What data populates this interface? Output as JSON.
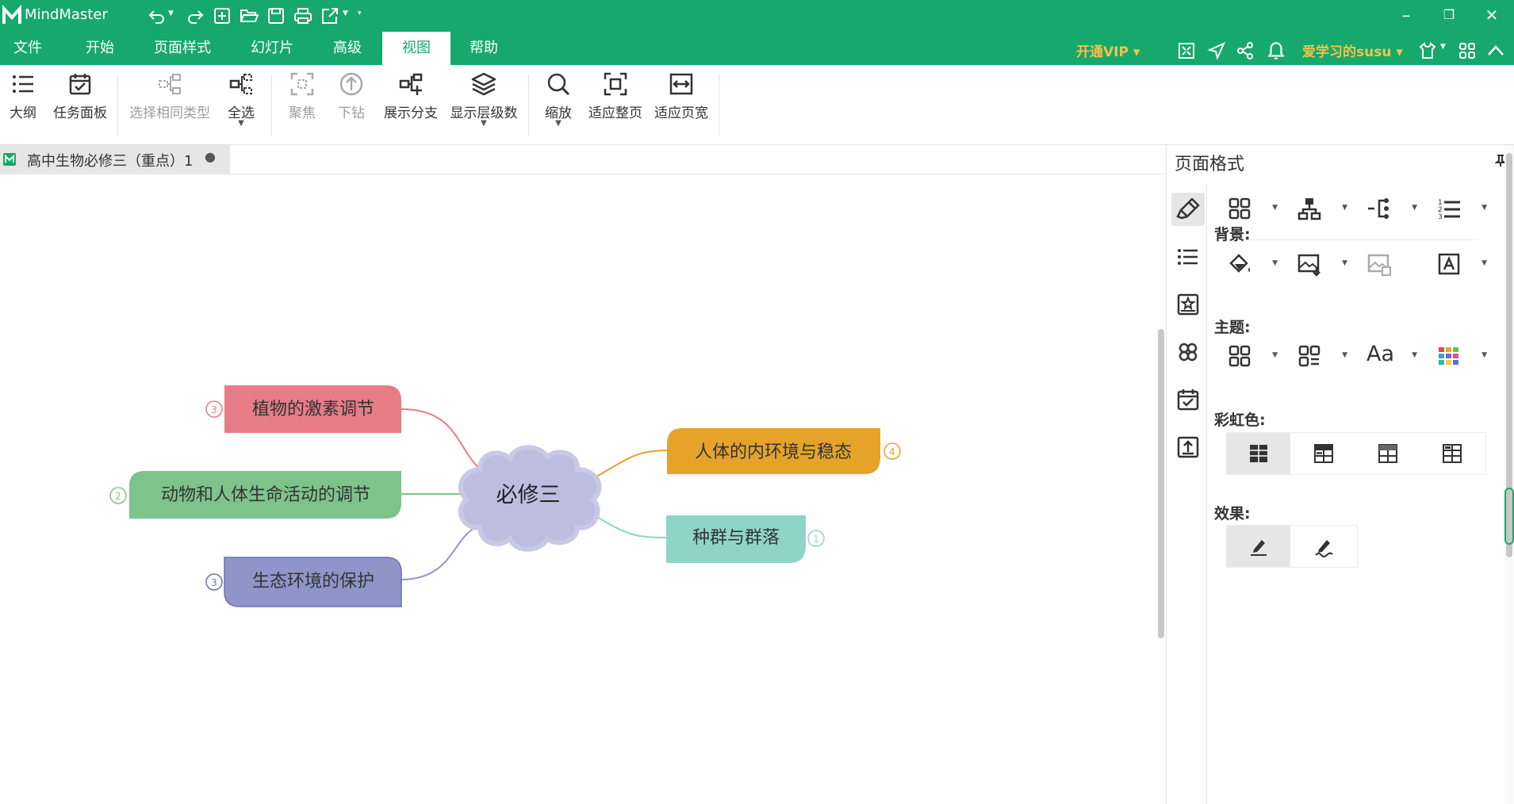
{
  "app": {
    "name": "MindMaster",
    "brand_color": "#17a86b"
  },
  "menu": {
    "items": [
      "文件",
      "开始",
      "页面样式",
      "幻灯片",
      "高级",
      "视图",
      "帮助"
    ],
    "active": "视图",
    "vip_label": "开通VIP",
    "user_label": "爱学习的susu"
  },
  "ribbon": {
    "tools": [
      {
        "label": "大纲",
        "icon": "outline-list-icon",
        "enabled": true
      },
      {
        "label": "任务面板",
        "icon": "task-calendar-icon",
        "enabled": true
      },
      {
        "label": "选择相同类型",
        "icon": "select-same-type-icon",
        "enabled": false
      },
      {
        "label": "全选",
        "icon": "select-all-icon",
        "enabled": true,
        "dropdown": true
      },
      {
        "label": "聚焦",
        "icon": "focus-icon",
        "enabled": false
      },
      {
        "label": "下钻",
        "icon": "drill-down-icon",
        "enabled": false
      },
      {
        "label": "展示分支",
        "icon": "show-branch-icon",
        "enabled": true
      },
      {
        "label": "显示层级数",
        "icon": "layers-icon",
        "enabled": true,
        "dropdown": true
      },
      {
        "label": "缩放",
        "icon": "zoom-icon",
        "enabled": true,
        "dropdown": true
      },
      {
        "label": "适应整页",
        "icon": "fit-page-icon",
        "enabled": true
      },
      {
        "label": "适应页宽",
        "icon": "fit-width-icon",
        "enabled": true
      }
    ]
  },
  "document": {
    "tab_title": "高中生物必修三（重点）1"
  },
  "mindmap": {
    "central": {
      "label": "必修三",
      "color": "#bdbde0"
    },
    "branches": [
      {
        "label": "植物的激素调节",
        "count": "3",
        "color": "#e57c86",
        "side": "left"
      },
      {
        "label": "动物和人体生命活动的调节",
        "count": "2",
        "color": "#7ec38a",
        "side": "left"
      },
      {
        "label": "生态环境的保护",
        "count": "3",
        "color": "#8f95c9",
        "side": "left"
      },
      {
        "label": "人体的内环境与稳态",
        "count": "4",
        "color": "#e5a32a",
        "side": "right"
      },
      {
        "label": "种群与群落",
        "count": "1",
        "color": "#8fd5c7",
        "side": "right"
      }
    ]
  },
  "panel": {
    "title": "页面格式",
    "background_label": "背景:",
    "theme_label": "主题:",
    "rainbow_label": "彩虹色:",
    "effect_label": "效果:",
    "theme_font_sample": "Aa"
  }
}
